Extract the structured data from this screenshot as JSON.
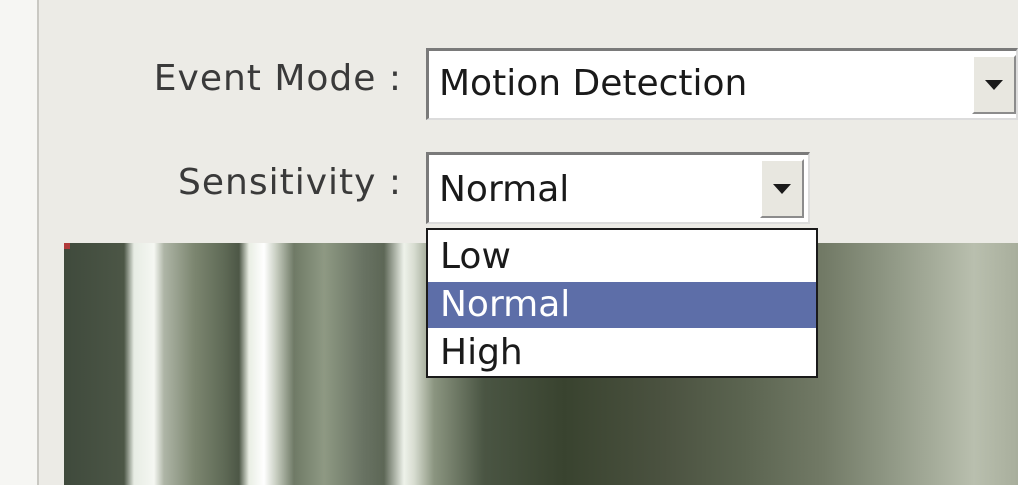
{
  "form": {
    "event_mode": {
      "label": "Event Mode :",
      "value": "Motion Detection"
    },
    "sensitivity": {
      "label": "Sensitivity :",
      "value": "Normal",
      "options": [
        "Low",
        "Normal",
        "High"
      ],
      "highlighted": "Normal"
    }
  },
  "icons": {
    "dropdown_arrow": "chevron-down-icon"
  },
  "colors": {
    "panel_background": "#ecebe6",
    "highlight": "#5d6ea8"
  }
}
